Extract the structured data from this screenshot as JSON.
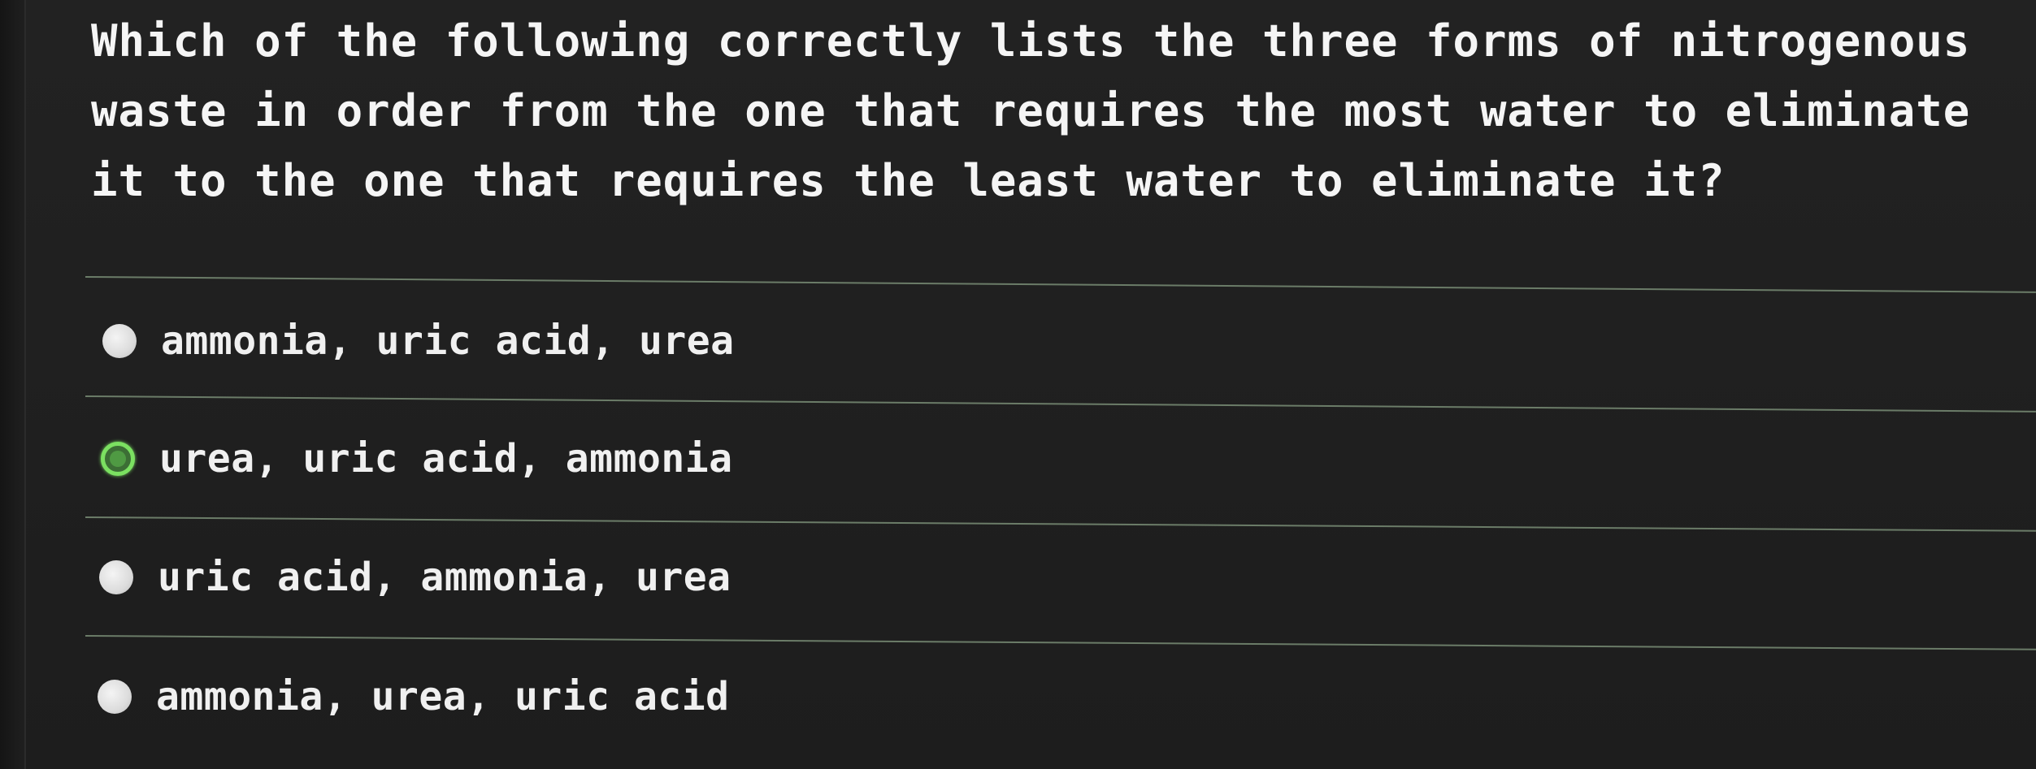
{
  "question": {
    "text": "Which of the following correctly lists the three forms of nitrogenous waste in order from the one that requires the most water to eliminate it to the one that requires the least water to eliminate it?"
  },
  "options": [
    {
      "label": "ammonia, uric acid, urea",
      "selected": false
    },
    {
      "label": "urea, uric acid, ammonia",
      "selected": true
    },
    {
      "label": "uric acid, ammonia, urea",
      "selected": false
    },
    {
      "label": "ammonia, urea, uric acid",
      "selected": false
    }
  ],
  "colors": {
    "background": "#1f1f1f",
    "text": "#f2f2f2",
    "selected_accent": "#7be061",
    "divider": "#6b7c68"
  }
}
